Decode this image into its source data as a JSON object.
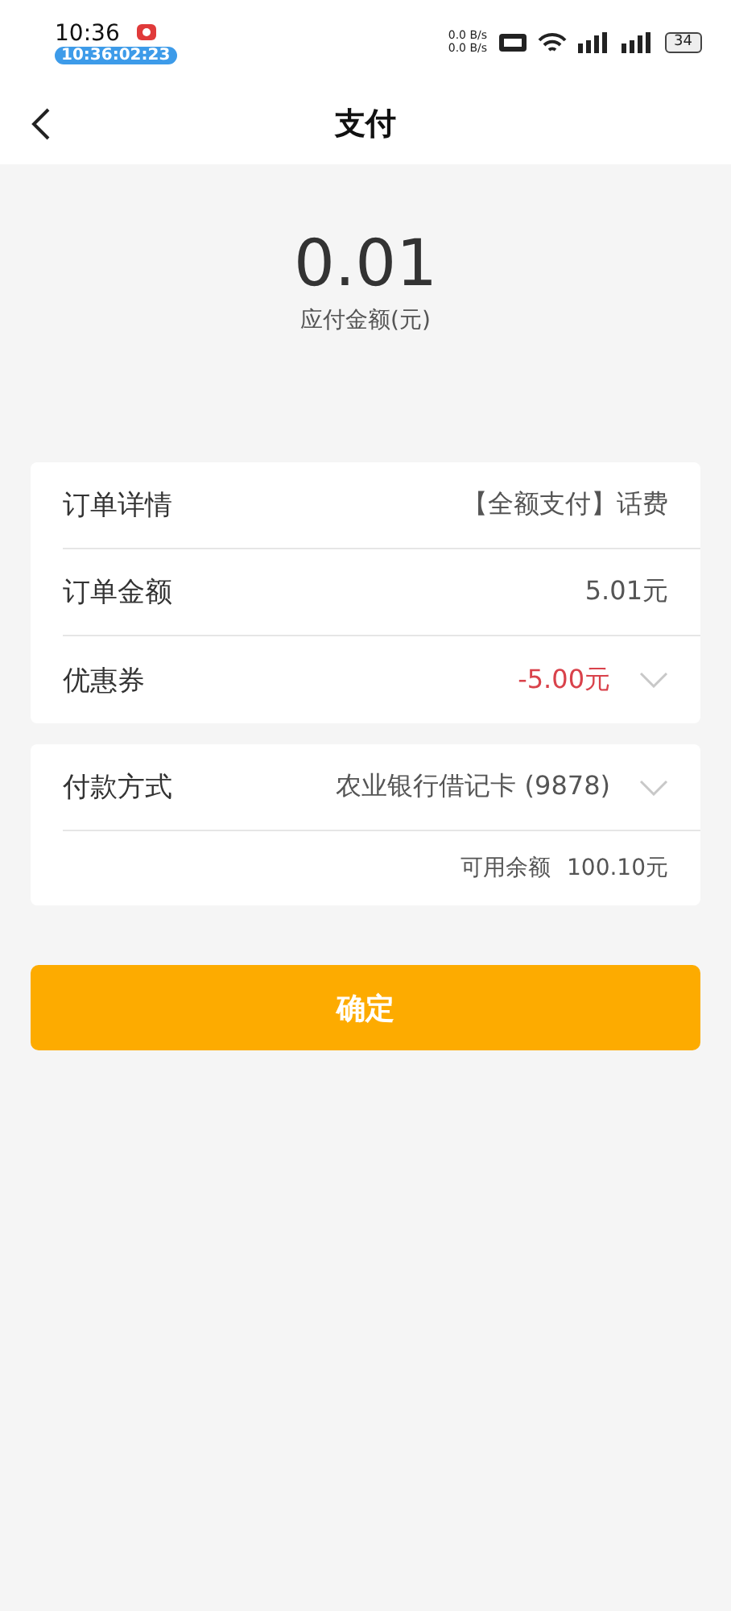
{
  "status_bar": {
    "time": "10:36",
    "recording_timer": "10:36:02:23",
    "net_speed": [
      "0.0 B/s",
      "0.0 B/s"
    ],
    "battery": "34"
  },
  "nav": {
    "title": "支付"
  },
  "amount": {
    "value": "0.01",
    "label": "应付金额(元)"
  },
  "order_card": {
    "rows": [
      {
        "label": "订单详情",
        "value": "【全额支付】话费",
        "kind": "plain",
        "dropdown": false
      },
      {
        "label": "订单金额",
        "value": "5.01元",
        "kind": "plain",
        "dropdown": false
      },
      {
        "label": "优惠券",
        "value": "-5.00元",
        "kind": "discount",
        "dropdown": true
      }
    ]
  },
  "payment_card": {
    "label": "付款方式",
    "value": "农业银行借记卡 (9878)",
    "dropdown": true,
    "balance_label": "可用余额",
    "balance": "100.10元"
  },
  "confirm_button": "确定"
}
